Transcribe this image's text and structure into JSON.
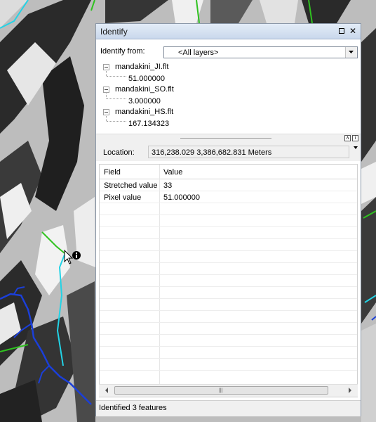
{
  "window": {
    "title": "Identify"
  },
  "identify_from": {
    "label": "Identify from:",
    "selected": "<All layers>"
  },
  "results_tree": [
    {
      "layer": "mandakini_JI.flt",
      "value": "51.000000"
    },
    {
      "layer": "mandakini_SO.flt",
      "value": "3.000000"
    },
    {
      "layer": "mandakini_HS.flt",
      "value": "167.134323"
    }
  ],
  "location": {
    "label": "Location:",
    "value": "316,238.029  3,386,682.831 Meters"
  },
  "table": {
    "headers": [
      "Field",
      "Value"
    ],
    "rows": [
      {
        "field": "Stretched value",
        "value": "33"
      },
      {
        "field": "Pixel value",
        "value": "51.000000"
      }
    ]
  },
  "status": {
    "text": "Identified 3 features"
  },
  "icons": {
    "maximize": "maximize-icon",
    "close": "close-icon",
    "dropdown": "chevron-down-icon",
    "identify_cursor": "identify-cursor-icon"
  },
  "colors": {
    "stream_blue": "#1b3fd9",
    "boundary_green": "#2fc21f",
    "boundary_cyan": "#22d3e6",
    "titlebar": "#d4e1f2"
  }
}
